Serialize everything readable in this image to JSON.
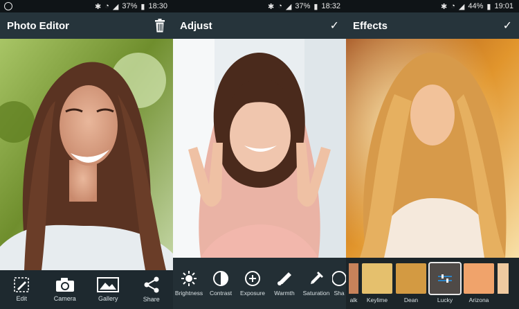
{
  "panels": [
    {
      "status_battery": "37%",
      "status_time": "18:30",
      "title": "Photo Editor",
      "right_icon": "trash-icon",
      "tools": [
        {
          "label": "Edit",
          "icon": "edit-icon"
        },
        {
          "label": "Camera",
          "icon": "camera-icon"
        },
        {
          "label": "Gallery",
          "icon": "gallery-icon"
        },
        {
          "label": "Share",
          "icon": "share-icon"
        }
      ]
    },
    {
      "status_battery": "37%",
      "status_time": "18:32",
      "title": "Adjust",
      "right_icon": "check-icon",
      "tools": [
        {
          "label": "Brightness",
          "icon": "brightness-icon"
        },
        {
          "label": "Contrast",
          "icon": "contrast-icon"
        },
        {
          "label": "Exposure",
          "icon": "exposure-icon"
        },
        {
          "label": "Warmth",
          "icon": "warmth-icon"
        },
        {
          "label": "Saturation",
          "icon": "saturation-icon"
        },
        {
          "label": "Sha",
          "icon": "sharpen-icon"
        }
      ]
    },
    {
      "status_battery": "44%",
      "status_time": "19:01",
      "title": "Effects",
      "right_icon": "check-icon",
      "effects": [
        {
          "label": "alk",
          "selected": false
        },
        {
          "label": "Keylime",
          "selected": false
        },
        {
          "label": "Dean",
          "selected": false
        },
        {
          "label": "Lucky",
          "selected": true
        },
        {
          "label": "Arizona",
          "selected": false
        },
        {
          "label": "",
          "selected": false
        }
      ]
    }
  ],
  "colors": {
    "appbar": "#26343b",
    "statusbar": "#0f1417",
    "toolbar": "#1e292f"
  }
}
